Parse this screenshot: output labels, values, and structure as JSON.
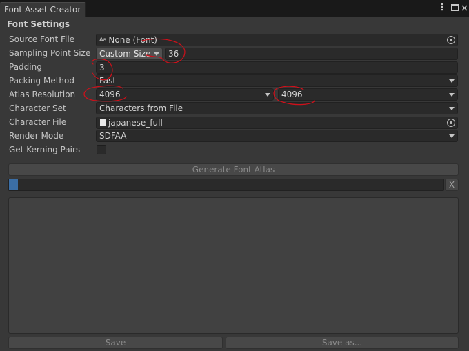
{
  "window": {
    "tab_title": "Font Asset Creator",
    "menu_icon": "kebab-menu-icon",
    "maximize_icon": "maximize-icon",
    "close_icon": "close-icon"
  },
  "section": {
    "title": "Font Settings"
  },
  "fields": {
    "source_font": {
      "label": "Source Font File",
      "value": "None (Font)",
      "icon": "font-asset-icon"
    },
    "sampling": {
      "label": "Sampling Point Size",
      "mode": "Custom Size",
      "value": "36"
    },
    "padding": {
      "label": "Padding",
      "value": "3"
    },
    "packing": {
      "label": "Packing Method",
      "value": "Fast"
    },
    "atlas": {
      "label": "Atlas Resolution",
      "width": "4096",
      "height": "4096"
    },
    "charset": {
      "label": "Character Set",
      "value": "Characters from File"
    },
    "charfile": {
      "label": "Character File",
      "value": "japanese_full",
      "icon": "text-file-icon"
    },
    "render": {
      "label": "Render Mode",
      "value": "SDFAA"
    },
    "kerning": {
      "label": "Get Kerning Pairs",
      "checked": false
    }
  },
  "actions": {
    "generate_label": "Generate Font Atlas",
    "cancel_label": "X",
    "progress": 0.005,
    "save_label": "Save",
    "save_as_label": "Save as..."
  },
  "colors": {
    "background": "#383838",
    "field": "#2a2a2a",
    "dropdown_button": "#515151",
    "annotation": "#d0101a",
    "progress": "#3b6ea5"
  }
}
